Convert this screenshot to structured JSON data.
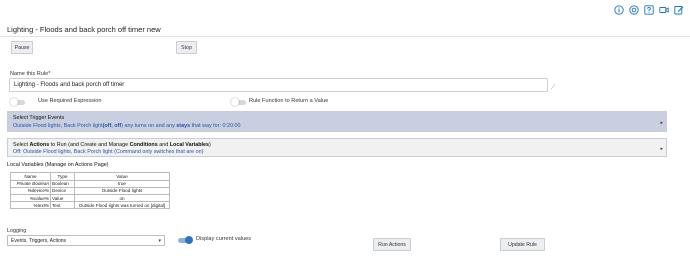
{
  "header": {
    "icons": [
      "info-icon",
      "help-icon",
      "question-icon",
      "video-icon",
      "edit-icon"
    ],
    "title": "Lighting - Floods and back porch off timer new"
  },
  "toolbar": {
    "pause_label": "Pause",
    "stop_label": "Stop"
  },
  "rule_name": {
    "label": "Name this Rule*",
    "value": "Lighting - Floods and back porch off timer"
  },
  "options": {
    "required_expression": {
      "label": "Use Required Expression",
      "on": false
    },
    "rule_function": {
      "label": "Rule Function to Return a Value",
      "on": false
    }
  },
  "trigger_section": {
    "title": "Select Trigger Events",
    "summary_parts": [
      {
        "text": "Outside Flood lights, Back Porch light",
        "bold": false
      },
      {
        "text": "(off, off",
        "bold": true
      },
      {
        "text": ") any turns on and any ",
        "bold": false
      },
      {
        "text": "stays",
        "bold": true
      },
      {
        "text": " that way for: 0:20:00",
        "bold": false
      }
    ]
  },
  "actions_section": {
    "title_parts": [
      {
        "text": "Select ",
        "bold": false
      },
      {
        "text": "Actions",
        "bold": true
      },
      {
        "text": " to Run (and Create and Manage ",
        "bold": false
      },
      {
        "text": "Conditions",
        "bold": true
      },
      {
        "text": " and ",
        "bold": false
      },
      {
        "text": "Local Variables",
        "bold": true
      },
      {
        "text": ")",
        "bold": false
      }
    ],
    "summary": "Off: Outside Flood lights, Back Porch light (Command only switches that are on)"
  },
  "local_variables": {
    "title": "Local Variables",
    "subtitle": " (Manage on Actions Page)",
    "columns": [
      "Name",
      "Type",
      "Value"
    ],
    "rows": [
      [
        "Private Boolean",
        "Boolean",
        "true"
      ],
      [
        "%device%",
        "Device",
        "Outside Flood lights"
      ],
      [
        "%value%",
        "Value",
        "on"
      ],
      [
        "%text%",
        "Text",
        "Outside Flood lights was turned on [digital]"
      ]
    ]
  },
  "logging": {
    "label": "Logging",
    "selected": "Events, Triggers, Actions",
    "display_current_values": {
      "label": "Display current values",
      "on": true
    }
  },
  "footer": {
    "run_actions_label": "Run Actions",
    "update_rule_label": "Update Rule"
  },
  "colors": {
    "accent": "#2f72c0",
    "trigger_bg": "#c9cfe0",
    "link_text": "#2753a8"
  }
}
